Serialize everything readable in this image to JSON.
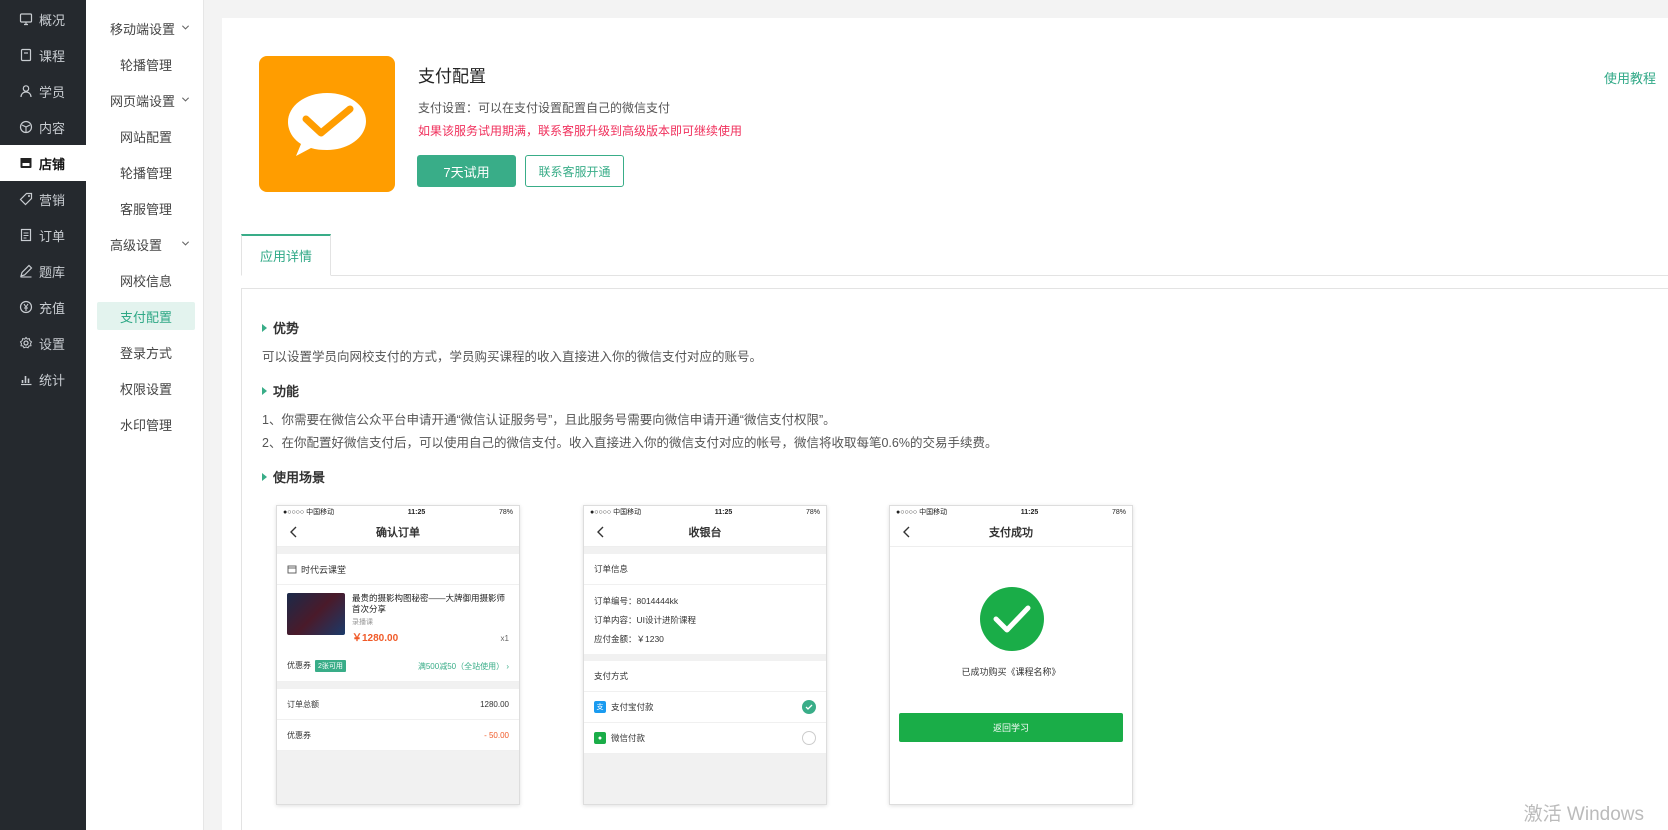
{
  "nav": {
    "items": [
      {
        "label": "概况",
        "icon": "monitor-icon"
      },
      {
        "label": "课程",
        "icon": "book-icon"
      },
      {
        "label": "学员",
        "icon": "user-icon"
      },
      {
        "label": "内容",
        "icon": "cube-icon"
      },
      {
        "label": "店铺",
        "icon": "store-icon",
        "active": true
      },
      {
        "label": "营销",
        "icon": "tag-icon"
      },
      {
        "label": "订单",
        "icon": "order-icon"
      },
      {
        "label": "题库",
        "icon": "pen-icon"
      },
      {
        "label": "充值",
        "icon": "yen-icon"
      },
      {
        "label": "设置",
        "icon": "gear-icon"
      },
      {
        "label": "统计",
        "icon": "chart-icon"
      }
    ]
  },
  "subnav": {
    "groups": [
      {
        "label": "移动端设置",
        "items": [
          "轮播管理"
        ]
      },
      {
        "label": "网页端设置",
        "items": [
          "网站配置",
          "轮播管理",
          "客服管理"
        ]
      },
      {
        "label": "高级设置",
        "items": [
          "网校信息",
          "支付配置",
          "登录方式",
          "权限设置",
          "水印管理"
        ]
      }
    ],
    "active_item": "支付配置"
  },
  "app": {
    "title": "支付配置",
    "desc": "支付设置：可以在支付设置配置自己的微信支付",
    "warning": "如果该服务试用期满，联系客服升级到高级版本即可继续使用",
    "trial_button": "7天试用",
    "contact_button": "联系客服开通",
    "tutorial_link": "使用教程",
    "icon_color": "#ff9d00"
  },
  "tabs": {
    "active": "应用详情"
  },
  "details": {
    "advantage_title": "优势",
    "advantage_text": "可以设置学员向网校支付的方式，学员购买课程的收入直接进入你的微信支付对应的账号。",
    "feature_title": "功能",
    "feature_1": "1、你需要在微信公众平台申请开通“微信认证服务号”，且此服务号需要向微信申请开通“微信支付权限”。",
    "feature_2": "2、在你配置好微信支付后，可以使用自己的微信支付。收入直接进入你的微信支付对应的帐号，微信将收取每笔0.6%的交易手续费。",
    "scene_title": "使用场景"
  },
  "phones": {
    "status": {
      "carrier": "●○○○○ 中国移动 ",
      "time": "11:25",
      "battery": "78%"
    },
    "order": {
      "title": "确认订单",
      "shop": "时代云课堂",
      "course_name": "最贵的摄影构图秘密——大牌御用摄影师首次分享",
      "course_type": "录播课",
      "price": "￥1280.00",
      "qty": "x1",
      "coupon_label": "优惠券",
      "coupon_tag": "2张可用",
      "coupon_value": "满500减50（全站使用）",
      "total_label": "订单总额",
      "total_value": "1280.00",
      "discount_label": "优惠券",
      "discount_value": "- 50.00"
    },
    "cashier": {
      "title": "收银台",
      "info_title": "订单信息",
      "order_no": "订单编号：8014444kk",
      "order_content": "订单内容：UI设计进阶课程",
      "order_amount": "应付金额：￥1230",
      "pay_method_title": "支付方式",
      "alipay": "支付宝付款",
      "wechat": "微信付款"
    },
    "success": {
      "title": "支付成功",
      "message": "已成功购买《课程名称》",
      "return_button": "返回学习"
    }
  },
  "watermark": "激活 Windows"
}
